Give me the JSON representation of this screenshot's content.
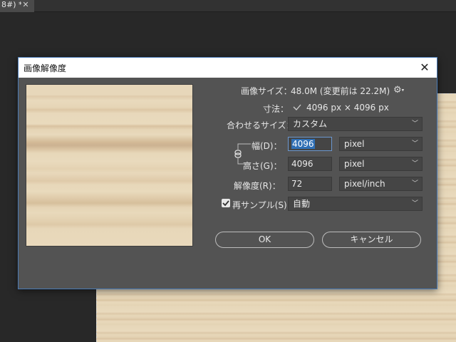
{
  "app": {
    "tab_title": "8#) *",
    "tab_close": "✕"
  },
  "dialog": {
    "title": "画像解像度",
    "close_glyph": "✕",
    "image_size_label": "画像サイズ：",
    "image_size_value": "48.0M (変更前は 22.2M)",
    "dimensions_label": "寸法：",
    "dimensions_value": "4096 px × 4096 px",
    "fit_to_label": "合わせるサイズ：",
    "fit_to_value": "カスタム",
    "width_label": "幅(D)：",
    "width_value": "4096",
    "width_unit": "pixel",
    "height_label": "高さ(G)：",
    "height_value": "4096",
    "height_unit": "pixel",
    "resolution_label": "解像度(R)：",
    "resolution_value": "72",
    "resolution_unit": "pixel/inch",
    "resample_checked": true,
    "resample_label": "再サンプル(S)：",
    "resample_value": "自動",
    "ok_label": "OK",
    "cancel_label": "キャンセル"
  },
  "icons": {
    "gear": "gear-icon",
    "dropdown_chevron": "chevron-down-icon",
    "checkmark": "checkmark-icon",
    "link": "link-icon",
    "close": "close-icon"
  },
  "colors": {
    "dialog_bg": "#535353",
    "field_bg": "#454545",
    "accent": "#2f6fb5",
    "dialog_border": "#4a7bb7"
  }
}
